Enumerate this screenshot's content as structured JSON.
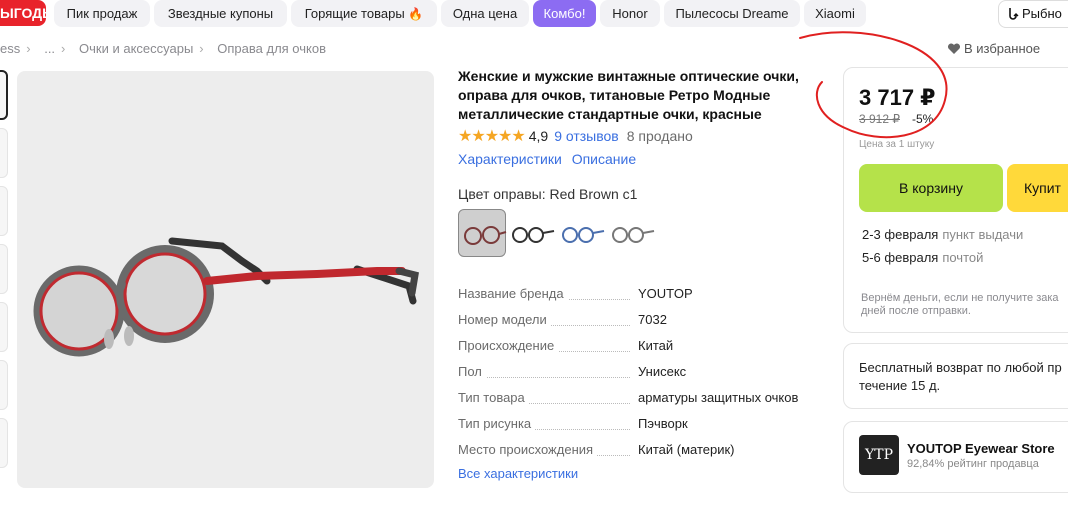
{
  "topbar": {
    "promo_label": "ЫГОДЫ",
    "chips": [
      {
        "label": "Пик продаж"
      },
      {
        "label": "Звездные купоны"
      },
      {
        "label": "Горящие товары"
      },
      {
        "label": "Одна цена"
      },
      {
        "label": "Комбо!"
      },
      {
        "label": "Honor"
      },
      {
        "label": "Пылесосы Dreame"
      },
      {
        "label": "Xiaomi"
      }
    ],
    "fishing_label": "Рыбно"
  },
  "breadcrumb": {
    "items": [
      "ess",
      "...",
      "Очки и аксессуары",
      "Оправа для очков"
    ],
    "favorite_label": "В избранное"
  },
  "product": {
    "title": "Женские и мужские винтажные оптические очки, оправа для очков, титановые Ретро Модные металлические стандартные очки, красные",
    "rating": "4,9",
    "reviews": "9 отзывов",
    "sold": "8 продано",
    "tab_specs": "Характеристики",
    "tab_description": "Описание",
    "color_label": "Цвет оправы: Red Brown c1",
    "swatches": [
      "red-brown",
      "black",
      "blue",
      "gray"
    ],
    "specs": [
      {
        "key": "Название бренда",
        "value": "YOUTOP"
      },
      {
        "key": "Номер модели",
        "value": "7032"
      },
      {
        "key": "Происхождение",
        "value": "Китай"
      },
      {
        "key": "Пол",
        "value": "Унисекс"
      },
      {
        "key": "Тип товара",
        "value": "арматуры защитных очков"
      },
      {
        "key": "Тип рисунка",
        "value": "Пэчворк"
      },
      {
        "key": "Место происхождения",
        "value": "Китай (материк)"
      }
    ],
    "all_specs_link": "Все характеристики"
  },
  "buy": {
    "price": "3 717 ₽",
    "old_price": "3 912 ₽",
    "discount": "-5%",
    "per_unit": "Цена за 1 штуку",
    "cart_button": "В корзину",
    "buy_button": "Купит",
    "delivery": [
      {
        "date": "2-3 февраля",
        "method": "пункт выдачи"
      },
      {
        "date": "5-6 февраля",
        "method": "почтой"
      }
    ],
    "refund_note": "Вернём деньги, если не получите зака дней после отправки."
  },
  "returns": {
    "text_line1": "Бесплатный возврат по любой пр",
    "text_line2": "течение 15 д."
  },
  "store": {
    "name": "YOUTOP Eyewear Store",
    "rating": "92,84% рейтинг продавца",
    "logo_text": "YTP"
  },
  "colors": {
    "accent_purple": "#8c6cf2",
    "promo_red": "#e8232b",
    "cart_green": "#b5e24a",
    "buy_yellow": "#ffd93a",
    "link_blue": "#3a6fe0",
    "star": "#f5a623",
    "annotation_red": "#e02020"
  }
}
